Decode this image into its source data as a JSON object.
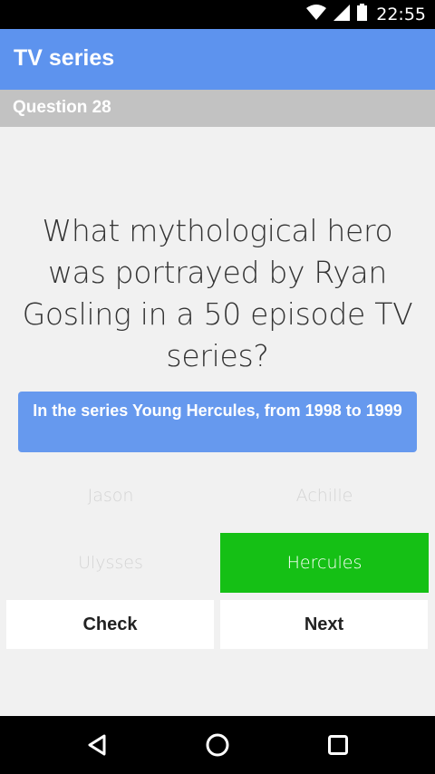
{
  "status_bar": {
    "time": "22:55",
    "icons": [
      "wifi-icon",
      "signal-icon",
      "battery-icon"
    ]
  },
  "app_bar": {
    "title": "TV series"
  },
  "question_bar": {
    "label": "Question 28"
  },
  "question": {
    "text": "What mythological hero was portrayed by Ryan Gosling in a 50 episode TV series?"
  },
  "hint": {
    "text": "In the series Young Hercules, from 1998 to 1999"
  },
  "answers": [
    {
      "label": "Jason",
      "selected": false
    },
    {
      "label": "Achille",
      "selected": false
    },
    {
      "label": "Ulysses",
      "selected": false
    },
    {
      "label": "Hercules",
      "selected": true
    }
  ],
  "buttons": {
    "check_label": "Check",
    "next_label": "Next"
  },
  "nav_bar": {
    "icons": [
      "back-icon",
      "home-icon",
      "recents-icon"
    ]
  },
  "colors": {
    "app_bar": "#5d93ee",
    "hint": "#6699ee",
    "selected_answer": "#15c015",
    "question_bar": "#c2c2c2"
  }
}
